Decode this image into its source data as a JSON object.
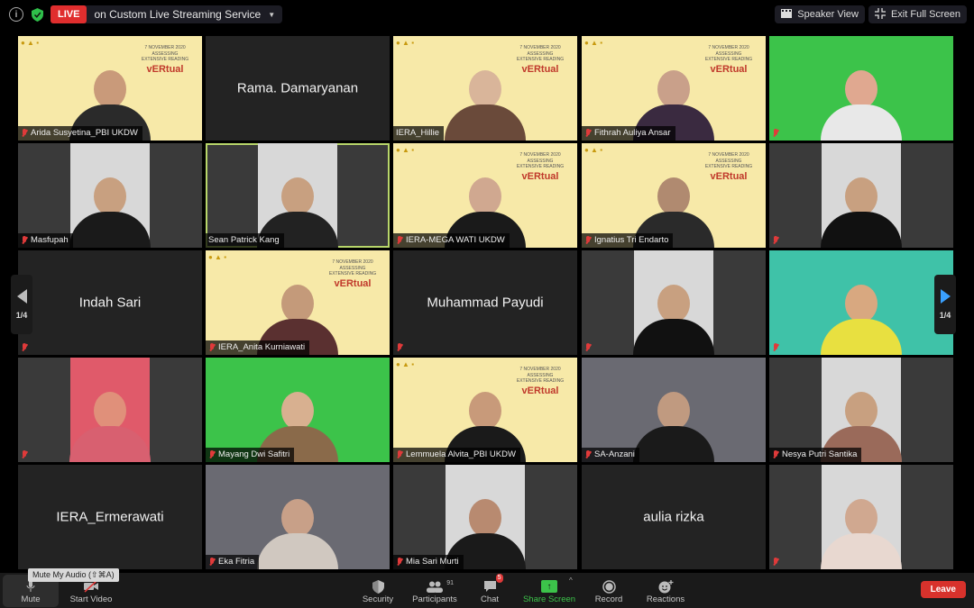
{
  "topbar": {
    "info_icon": "info-icon",
    "shield_icon": "encryption-shield-icon",
    "live_badge": "LIVE",
    "live_text": "on Custom Live Streaming Service",
    "speaker_view": "Speaker View",
    "exit_full_screen": "Exit Full Screen"
  },
  "pager": {
    "left_text": "1/4",
    "right_text": "1/4"
  },
  "tiles": [
    {
      "name": "Arida Susyetina_PBI UKDW",
      "mode": "video",
      "muted": true
    },
    {
      "name": "Rama. Damaryanan",
      "mode": "name-only",
      "muted": false
    },
    {
      "name": "IERA_Hillie",
      "mode": "video",
      "muted": false
    },
    {
      "name": "Fithrah Auliya Ansar",
      "mode": "video",
      "muted": true
    },
    {
      "name": "",
      "mode": "video",
      "muted": true
    },
    {
      "name": "Masfupah",
      "mode": "video",
      "muted": true
    },
    {
      "name": "Sean Patrick Kang",
      "mode": "video",
      "muted": false,
      "active_speaker": true
    },
    {
      "name": "IERA-MEGA WATI UKDW",
      "mode": "video",
      "muted": true
    },
    {
      "name": "Ignatius Tri Endarto",
      "mode": "video",
      "muted": true
    },
    {
      "name": "",
      "mode": "video",
      "muted": true
    },
    {
      "name": "Indah Sari",
      "mode": "name-only",
      "muted": true
    },
    {
      "name": "IERA_Anita Kurniawati",
      "mode": "video",
      "muted": true
    },
    {
      "name": "Muhammad Payudi",
      "mode": "name-only",
      "muted": true
    },
    {
      "name": "",
      "mode": "video",
      "muted": true
    },
    {
      "name": "",
      "mode": "video",
      "muted": true
    },
    {
      "name": "",
      "mode": "video",
      "muted": true
    },
    {
      "name": "Mayang Dwi Safitri",
      "mode": "video",
      "muted": true
    },
    {
      "name": "Lemmuela Alvita_PBI UKDW",
      "mode": "video",
      "muted": true
    },
    {
      "name": "SA-Anzani",
      "mode": "video",
      "muted": true
    },
    {
      "name": "Nesya Putri Santika",
      "mode": "video",
      "muted": true
    },
    {
      "name": "IERA_Ermerawati",
      "mode": "name-only",
      "muted": false
    },
    {
      "name": "Eka Fitria",
      "mode": "video",
      "muted": true
    },
    {
      "name": "Mia Sari Murti",
      "mode": "video",
      "muted": true
    },
    {
      "name": "aulia rizka",
      "mode": "name-only",
      "muted": false
    },
    {
      "name": "",
      "mode": "video",
      "muted": true
    }
  ],
  "banner": {
    "line1": "7 NOVEMBER 2020",
    "line2": "ASSESSING",
    "line3": "EXTENSIVE READING",
    "brand": "vERtual"
  },
  "toolbar": {
    "tooltip": "Mute My Audio (⇧⌘A)",
    "mute": "Mute",
    "start_video": "Start Video",
    "security": "Security",
    "participants": "Participants",
    "participants_count": "91",
    "chat": "Chat",
    "chat_badge": "5",
    "share_screen": "Share Screen",
    "record": "Record",
    "reactions": "Reactions",
    "leave": "Leave"
  },
  "colors": {
    "live": "#e02e2e",
    "share": "#3cc34a",
    "leave": "#d8322c",
    "active_speaker": "#b8d66a",
    "next_page": "#3aa0ff"
  }
}
